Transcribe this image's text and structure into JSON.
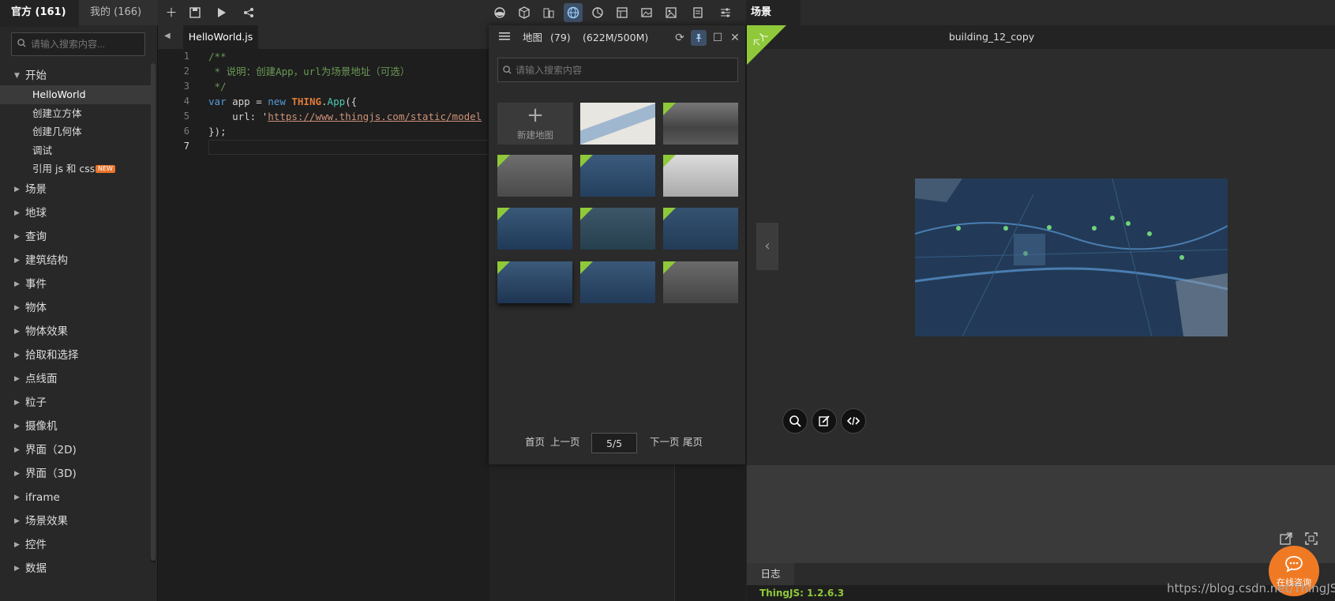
{
  "left_tabs": {
    "official": "官方 (161)",
    "mine": "我的 (166)"
  },
  "left_search": {
    "placeholder": "请输入搜索内容..."
  },
  "tree": {
    "start": "开始",
    "children": [
      {
        "label": "HelloWorld"
      },
      {
        "label": "创建立方体"
      },
      {
        "label": "创建几何体"
      },
      {
        "label": "调试"
      },
      {
        "label": "引用 js 和 css",
        "badge": "NEW"
      }
    ],
    "categories": [
      "场景",
      "地球",
      "查询",
      "建筑结构",
      "事件",
      "物体",
      "物体效果",
      "拾取和选择",
      "点线面",
      "粒子",
      "摄像机",
      "界面（2D)",
      "界面（3D)",
      "iframe",
      "场景效果",
      "控件",
      "数据"
    ]
  },
  "toolbar": {
    "icons": [
      "add-icon",
      "save-icon",
      "run-icon",
      "share-icon",
      "terrain-icon",
      "cube-icon",
      "building-icon",
      "globe-icon",
      "chart-icon",
      "layout-icon",
      "image-icon",
      "picture-icon",
      "notebook-icon",
      "settings-sliders-icon"
    ]
  },
  "editor": {
    "file_tab": "HelloWorld.js",
    "line_numbers": [
      "1",
      "2",
      "3",
      "4",
      "5",
      "6",
      "7"
    ],
    "lines": {
      "l1": "/**",
      "l2": " * 说明：创建App，url为场景地址（可选）",
      "l3": " */",
      "l4_kw": "var",
      "l4_a": " app = ",
      "l4_new": "new",
      "l4_cls": "THING",
      "l4_fn": "App",
      "l4_b": "({",
      "l5_a": "    url: '",
      "l5_url": "https://www.thingjs.com/static/model",
      "l6": "});"
    }
  },
  "map_popup": {
    "title": "地图",
    "count": "(79)",
    "size": "(622M/500M)",
    "search_placeholder": "请输入搜索内容",
    "new_map": "新建地图",
    "thumbnail_count_visible": 11,
    "pager": {
      "first": "首页",
      "prev": "上一页",
      "page": "5/5",
      "next": "下一页",
      "last": "尾页"
    }
  },
  "scene": {
    "tab": "场景",
    "name": "building_12_copy",
    "badge": "个人",
    "log_tab": "日志",
    "version": "ThingJS: 1.2.6.3",
    "watermark": "https://blog.csdn.net/ThingJS",
    "chat": "在线咨询"
  },
  "colors": {
    "accent_green": "#8fc93a",
    "active_blue": "#3e5068",
    "chat_orange": "#f07a24",
    "brand_orange": "#e07b39"
  }
}
